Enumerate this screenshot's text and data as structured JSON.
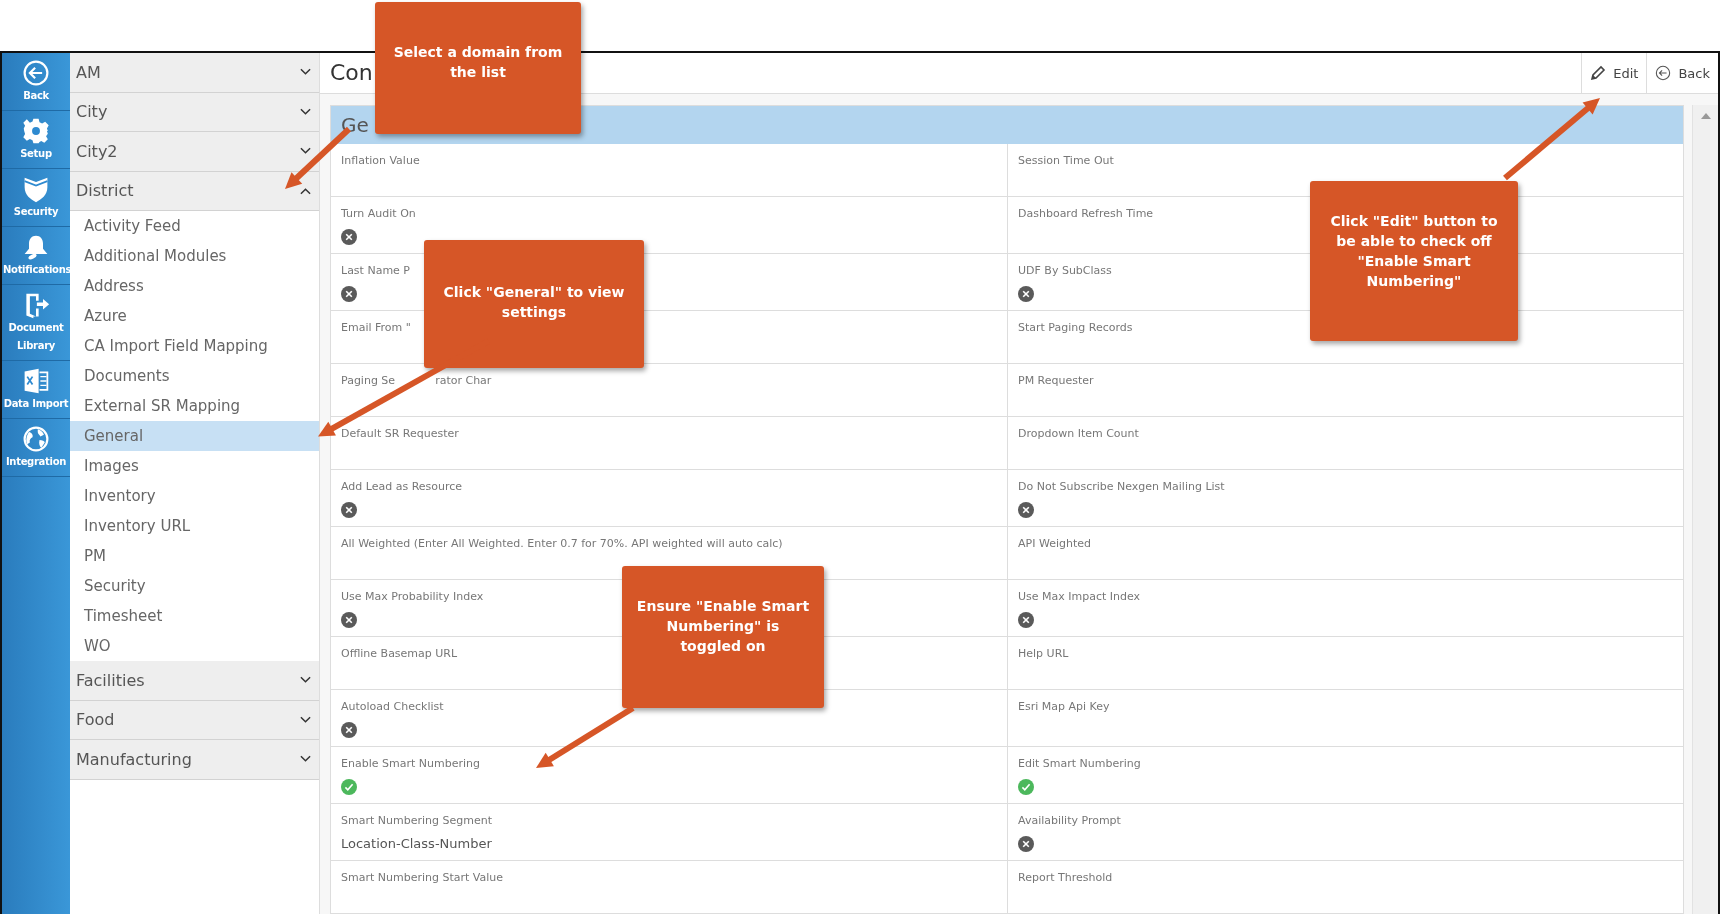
{
  "rail": [
    {
      "label": "Back"
    },
    {
      "label": "Setup"
    },
    {
      "label": "Security"
    },
    {
      "label": "Notifications"
    },
    {
      "label": "Document Library"
    },
    {
      "label": "Data Import"
    },
    {
      "label": "Integration"
    }
  ],
  "domains": [
    {
      "label": "AM",
      "expanded": false
    },
    {
      "label": "City",
      "expanded": false
    },
    {
      "label": "City2",
      "expanded": false
    },
    {
      "label": "District",
      "expanded": true,
      "children": [
        {
          "label": "Activity Feed",
          "selected": false
        },
        {
          "label": "Additional Modules",
          "selected": false
        },
        {
          "label": "Address",
          "selected": false
        },
        {
          "label": "Azure",
          "selected": false
        },
        {
          "label": "CA Import Field Mapping",
          "selected": false
        },
        {
          "label": "Documents",
          "selected": false
        },
        {
          "label": "External SR Mapping",
          "selected": false
        },
        {
          "label": "General",
          "selected": true
        },
        {
          "label": "Images",
          "selected": false
        },
        {
          "label": "Inventory",
          "selected": false
        },
        {
          "label": "Inventory URL",
          "selected": false
        },
        {
          "label": "PM",
          "selected": false
        },
        {
          "label": "Security",
          "selected": false
        },
        {
          "label": "Timesheet",
          "selected": false
        },
        {
          "label": "WO",
          "selected": false
        }
      ]
    },
    {
      "label": "Facilities",
      "expanded": false
    },
    {
      "label": "Food",
      "expanded": false
    },
    {
      "label": "Manufacturing",
      "expanded": false
    }
  ],
  "page": {
    "title": "Con",
    "buttons": [
      {
        "label": "Edit"
      },
      {
        "label": "Back"
      }
    ]
  },
  "section": {
    "title": "Ge",
    "rows": [
      [
        {
          "label": "Inflation Value",
          "kind": "empty"
        },
        {
          "label": "Session Time Out",
          "kind": "empty"
        }
      ],
      [
        {
          "label": "Turn Audit On",
          "kind": "toggle",
          "on": false
        },
        {
          "label": "Dashboard Refresh Time",
          "kind": "empty"
        }
      ],
      [
        {
          "label": "Last Name P",
          "kind": "toggle",
          "on": false
        },
        {
          "label": "UDF By SubClass",
          "kind": "toggle",
          "on": false
        }
      ],
      [
        {
          "label": "Email From \"",
          "kind": "empty"
        },
        {
          "label": "Start Paging Records",
          "kind": "empty"
        }
      ],
      [
        {
          "label": [
            "Paging Se",
            "rator Char"
          ],
          "kind": "empty"
        },
        {
          "label": "PM Requester",
          "kind": "empty"
        }
      ],
      [
        {
          "label": "Default SR Requester",
          "kind": "empty"
        },
        {
          "label": "Dropdown Item Count",
          "kind": "empty"
        }
      ],
      [
        {
          "label": "Add Lead as Resource",
          "kind": "toggle",
          "on": false
        },
        {
          "label": "Do Not Subscribe Nexgen Mailing List",
          "kind": "toggle",
          "on": false
        }
      ],
      [
        {
          "label": "All Weighted (Enter All Weighted. Enter 0.7 for 70%. API weighted will auto calc)",
          "kind": "empty"
        },
        {
          "label": "API Weighted",
          "kind": "empty"
        }
      ],
      [
        {
          "label": "Use Max Probability Index",
          "kind": "toggle",
          "on": false
        },
        {
          "label": "Use Max Impact Index",
          "kind": "toggle",
          "on": false
        }
      ],
      [
        {
          "label": "Offline Basemap URL",
          "kind": "empty"
        },
        {
          "label": "Help URL",
          "kind": "empty"
        }
      ],
      [
        {
          "label": "Autoload Checklist",
          "kind": "toggle",
          "on": false
        },
        {
          "label": "Esri Map Api Key",
          "kind": "empty"
        }
      ],
      [
        {
          "label": "Enable Smart Numbering",
          "kind": "toggle",
          "on": true
        },
        {
          "label": "Edit Smart Numbering",
          "kind": "toggle",
          "on": true
        }
      ],
      [
        {
          "label": "Smart Numbering Segment",
          "kind": "text",
          "value": "Location-Class-Number"
        },
        {
          "label": "Availability Prompt",
          "kind": "toggle",
          "on": false
        }
      ],
      [
        {
          "label": "Smart Numbering Start Value",
          "kind": "empty"
        },
        {
          "label": "Report Threshold",
          "kind": "empty"
        }
      ]
    ]
  },
  "annotations": [
    {
      "text": "Select a domain from the list"
    },
    {
      "text": "Click \"General\" to view settings"
    },
    {
      "text": "Click \"Edit\" button to be able to check off \"Enable Smart Numbering\""
    },
    {
      "text": "Ensure \"Enable Smart Numbering\" is toggled on"
    }
  ]
}
